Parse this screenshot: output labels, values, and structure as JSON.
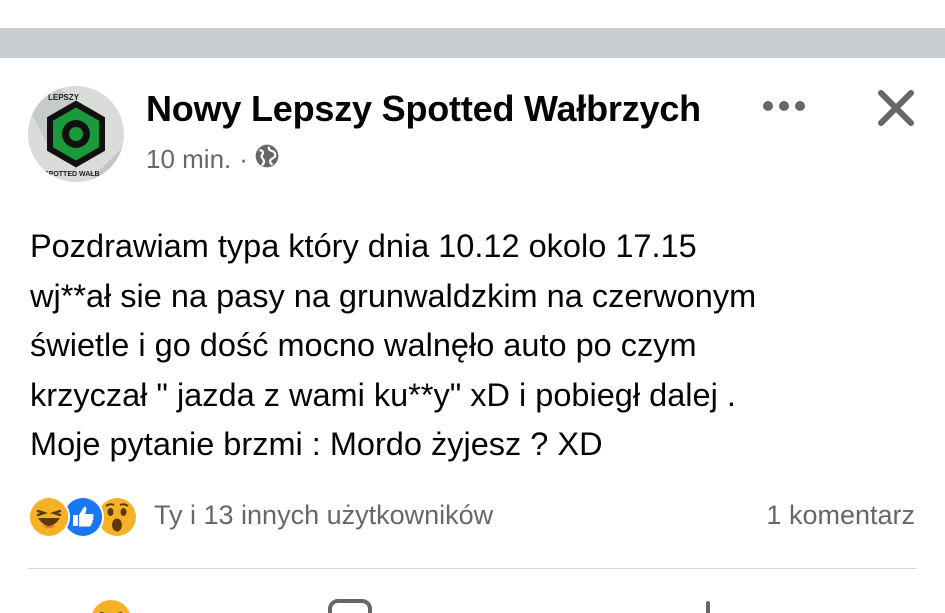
{
  "post": {
    "author": "Nowy Lepszy Spotted Wałbrzych",
    "time": "10 min.",
    "separator": "·",
    "visibility_icon": "globe-icon",
    "avatar": {
      "icon": "hex-nut-logo",
      "text_top": "LEPSZY",
      "text_bottom": "SPOTTED WAŁB",
      "colors": {
        "hex": "#1a9a3b",
        "ring": "#111111",
        "bg": "#d9dcd9"
      }
    },
    "menu_icon": "more-dots-icon",
    "close_icon": "close-icon",
    "text_lines": [
      "Pozdrawiam typa który dnia 10.12 okolo 17.15",
      "wj**ał sie na pasy na grunwaldzkim na czerwonym",
      "świetle i go dość mocno walnęło auto po czym",
      "krzyczał \" jazda z wami ku**y\" xD i pobiegł dalej .",
      "Moje pytanie brzmi : Mordo żyjesz ? XD"
    ]
  },
  "reactions": {
    "icons": [
      "haha-icon",
      "like-icon",
      "wow-icon"
    ],
    "summary": "Ty i 13 innych użytkowników",
    "comments": "1 komentarz"
  },
  "actions": {
    "icons": [
      "react-icon",
      "comment-icon",
      "share-icon"
    ]
  },
  "colors": {
    "text": "#050505",
    "secondary": "#65676b",
    "band": "#c9ccd1",
    "like_blue": "#1877f2",
    "emoji_yellow": "#f7b125"
  }
}
